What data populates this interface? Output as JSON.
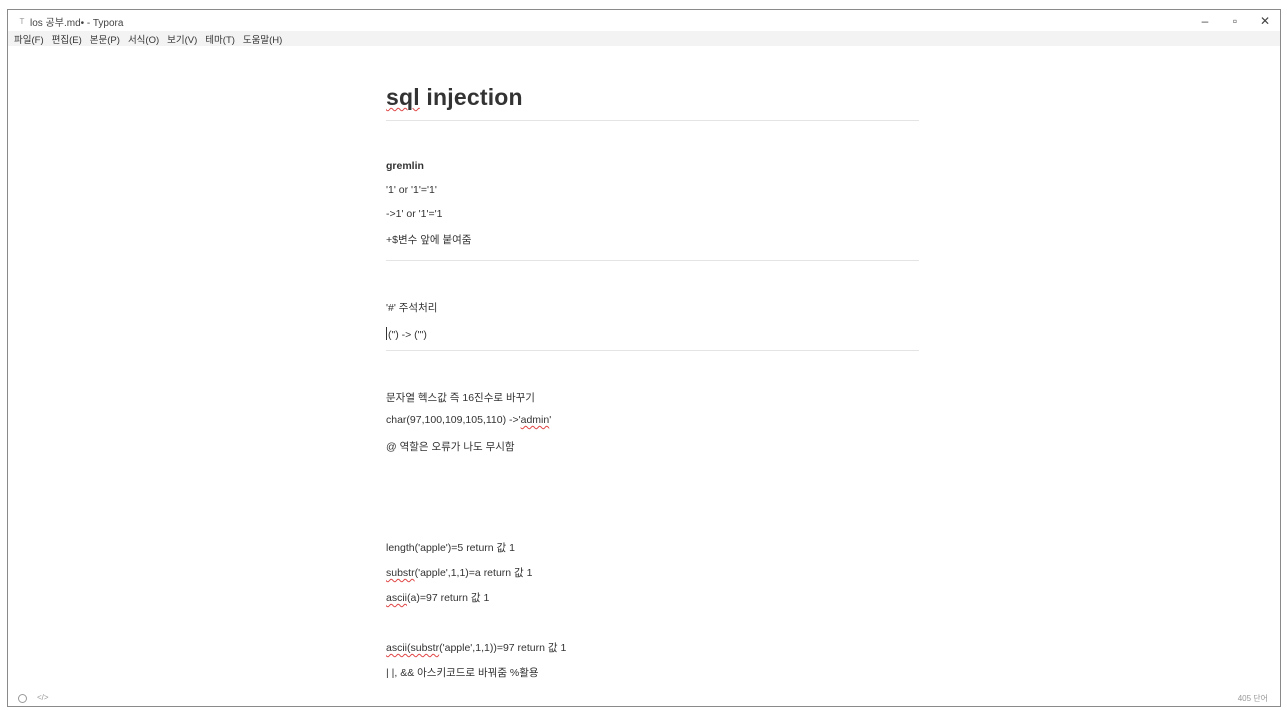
{
  "window": {
    "title": "los 공부.md• - Typora",
    "app_icon": "typora-icon",
    "minimize_glyph": "–",
    "maximize_glyph": "▫",
    "close_glyph": "✕"
  },
  "menu": [
    "파일(F)",
    "편집(E)",
    "본문(P)",
    "서식(O)",
    "보기(V)",
    "테마(T)",
    "도움말(H)"
  ],
  "document": {
    "heading": {
      "pre": "",
      "sq": "sql",
      "post": " injection"
    },
    "lines": [
      {
        "pre": "gremlin",
        "sq": "",
        "post": ""
      },
      {
        "pre": "'1' or '1'='1'",
        "sq": "",
        "post": ""
      },
      {
        "pre": "->1' or '1'='1",
        "sq": "",
        "post": ""
      },
      {
        "pre": "+$변수 앞에 붙여줌",
        "sq": "",
        "post": ""
      },
      {
        "pre": "'#' 주석처리",
        "sq": "",
        "post": ""
      },
      {
        "pre": "(\") -> (\"')",
        "sq": "",
        "post": ""
      },
      {
        "pre": "문자열 헥스값 즉 16진수로 바꾸기",
        "sq": "",
        "post": ""
      },
      {
        "pre": "char(97,100,109,105,110)   ->'",
        "sq": "admin",
        "post": "'"
      },
      {
        "pre": "@ 역할은 오류가 나도 무시함",
        "sq": "",
        "post": ""
      },
      {
        "pre": "length('apple')=5   return 값 1",
        "sq": "",
        "post": ""
      },
      {
        "pre": "",
        "sq": "substr",
        "post": "('apple',1,1)=a  return 값 1"
      },
      {
        "pre": "",
        "sq": "ascii",
        "post": "(a)=97 return 값 1"
      },
      {
        "pre": "",
        "sq": "ascii(substr",
        "post": "('apple',1,1))=97   return 값 1"
      },
      {
        "pre": "| |, && 아스키코드로 바꿔줌 %활용",
        "sq": "",
        "post": ""
      }
    ]
  },
  "status": {
    "left_icon": "circle-icon",
    "code_icon": "code-icon",
    "code_glyph": "</>",
    "word_count": "405 단어"
  }
}
